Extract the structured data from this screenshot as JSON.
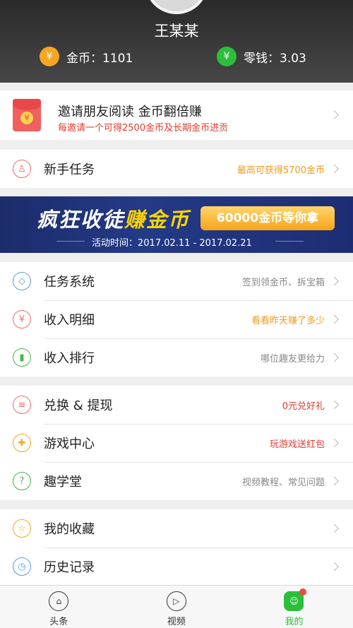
{
  "profile": {
    "name": "王某某",
    "coins_label": "金币：1101",
    "change_label": "零钱：3.03"
  },
  "invite": {
    "title": "邀请朋友阅读 金币翻倍赚",
    "subtitle": "每邀请一个可得2500金币及长期金币进贡"
  },
  "newbie": {
    "label": "新手任务",
    "hint": "最高可获得5700金币"
  },
  "promo": {
    "headline_part1": "疯狂收徒",
    "headline_part2": "赚金币",
    "pill": "60000金币等你拿",
    "date": "活动时间：2017.02.11 - 2017.02.21"
  },
  "menu1": [
    {
      "label": "任务系统",
      "hint": "签到领金币、拆宝箱"
    },
    {
      "label": "收入明细",
      "hint": "看看昨天赚了多少"
    },
    {
      "label": "收入排行",
      "hint": "哪位趣友更给力"
    }
  ],
  "menu2": [
    {
      "label": "兑换 & 提现",
      "hint": "0元兑好礼"
    },
    {
      "label": "游戏中心",
      "hint": "玩游戏送红包"
    },
    {
      "label": "趣学堂",
      "hint": "视频教程、常见问题"
    }
  ],
  "menu3": [
    {
      "label": "我的收藏"
    },
    {
      "label": "历史记录"
    }
  ],
  "tabs": [
    {
      "label": "头条"
    },
    {
      "label": "视频"
    },
    {
      "label": "我的"
    }
  ]
}
